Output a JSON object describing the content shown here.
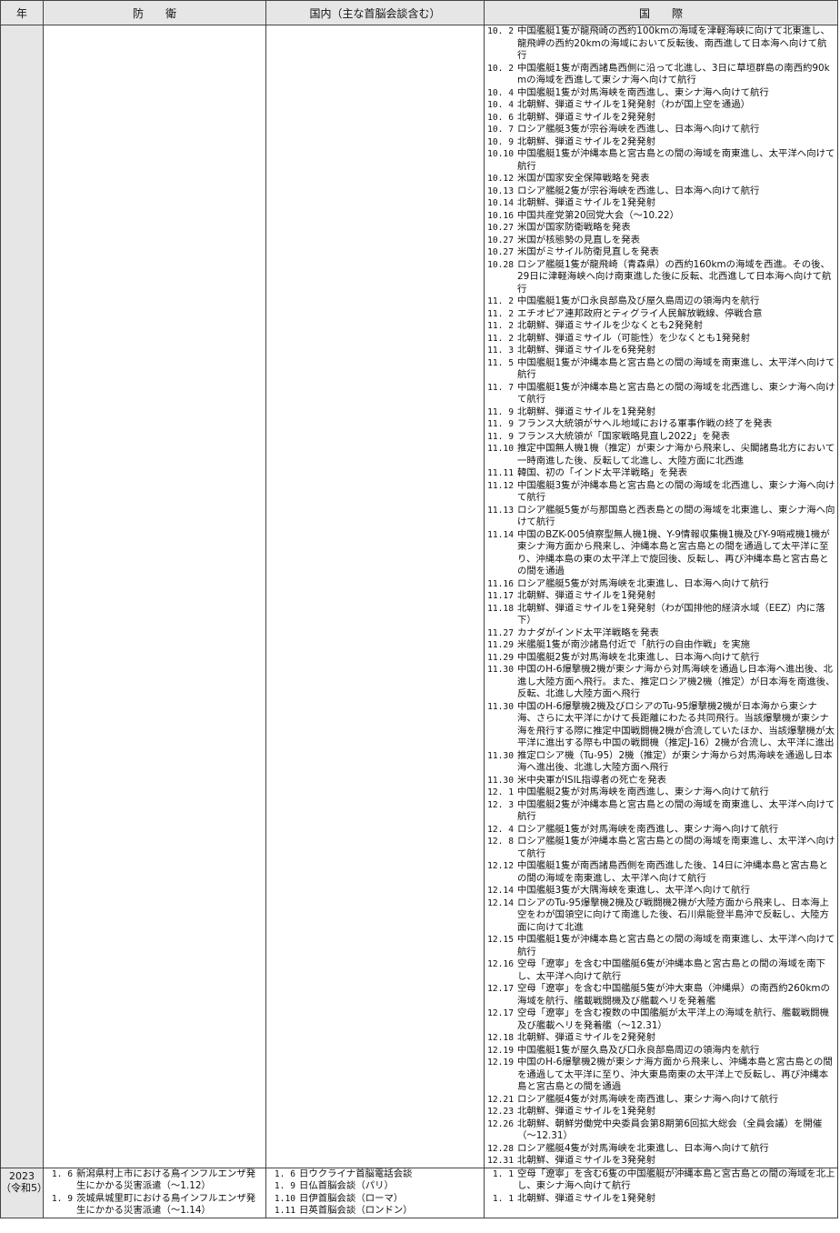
{
  "header": {
    "year": "年",
    "defense": "防　　衛",
    "domestic": "国内（主な首脳会談含む）",
    "international": "国　　際"
  },
  "rows": [
    {
      "year": "",
      "defense": [],
      "domestic": [],
      "international": [
        {
          "date": "10. 2",
          "text": "中国艦艇1隻が龍飛崎の西約100kmの海域を津軽海峡に向けて北東進し、龍飛岬の西約20kmの海域において反転後、南西進して日本海へ向けて航行"
        },
        {
          "date": "10. 2",
          "text": "中国艦艇1隻が南西諸島西側に沿って北進し、3日に草垣群島の南西約90kmの海域を西進して東シナ海へ向けて航行"
        },
        {
          "date": "10. 4",
          "text": "中国艦艇1隻が対馬海峡を南西進し、東シナ海へ向けて航行"
        },
        {
          "date": "10. 4",
          "text": "北朝鮮、弾道ミサイルを1発発射（わが国上空を通過）"
        },
        {
          "date": "10. 6",
          "text": "北朝鮮、弾道ミサイルを2発発射"
        },
        {
          "date": "10. 7",
          "text": "ロシア艦艇3隻が宗谷海峡を西進し、日本海へ向けて航行"
        },
        {
          "date": "10. 9",
          "text": "北朝鮮、弾道ミサイルを2発発射"
        },
        {
          "date": "10.10",
          "text": "中国艦艇1隻が沖縄本島と宮古島との間の海域を南東進し、太平洋へ向けて航行"
        },
        {
          "date": "10.12",
          "text": "米国が国家安全保障戦略を発表"
        },
        {
          "date": "10.13",
          "text": "ロシア艦艇2隻が宗谷海峡を西進し、日本海へ向けて航行"
        },
        {
          "date": "10.14",
          "text": "北朝鮮、弾道ミサイルを1発発射"
        },
        {
          "date": "10.16",
          "text": "中国共産党第20回党大会（～10.22）"
        },
        {
          "date": "10.27",
          "text": "米国が国家防衛戦略を発表"
        },
        {
          "date": "10.27",
          "text": "米国が核態勢の見直しを発表"
        },
        {
          "date": "10.27",
          "text": "米国がミサイル防衛見直しを発表"
        },
        {
          "date": "10.28",
          "text": "ロシア艦艇1隻が龍飛崎（青森県）の西約160kmの海域を西進。その後、29日に津軽海峡へ向け南東進した後に反転、北西進して日本海へ向けて航行"
        },
        {
          "date": "11. 2",
          "text": "中国艦艇1隻が口永良部島及び屋久島周辺の領海内を航行"
        },
        {
          "date": "11. 2",
          "text": "エチオピア連邦政府とティグライ人民解放戦線、停戦合意"
        },
        {
          "date": "11. 2",
          "text": "北朝鮮、弾道ミサイルを少なくとも2発発射"
        },
        {
          "date": "11. 2",
          "text": "北朝鮮、弾道ミサイル（可能性）を少なくとも1発発射"
        },
        {
          "date": "11. 3",
          "text": "北朝鮮、弾道ミサイルを6発発射"
        },
        {
          "date": "11. 5",
          "text": "中国艦艇1隻が沖縄本島と宮古島との間の海域を南東進し、太平洋へ向けて航行"
        },
        {
          "date": "11. 7",
          "text": "中国艦艇1隻が沖縄本島と宮古島との間の海域を北西進し、東シナ海へ向けて航行"
        },
        {
          "date": "11. 9",
          "text": "北朝鮮、弾道ミサイルを1発発射"
        },
        {
          "date": "11. 9",
          "text": "フランス大統領がサヘル地域における軍事作戦の終了を発表"
        },
        {
          "date": "11. 9",
          "text": "フランス大統領が「国家戦略見直し2022」を発表"
        },
        {
          "date": "11.10",
          "text": "推定中国無人機1機（推定）が東シナ海から飛来し、尖閣諸島北方において一時南進した後、反転して北進し、大陸方面に北西進"
        },
        {
          "date": "11.11",
          "text": "韓国、初の「インド太平洋戦略」を発表"
        },
        {
          "date": "11.12",
          "text": "中国艦艇3隻が沖縄本島と宮古島との間の海域を北西進し、東シナ海へ向けて航行"
        },
        {
          "date": "11.13",
          "text": "ロシア艦艇5隻が与那国島と西表島との間の海域を北東進し、東シナ海へ向けて航行"
        },
        {
          "date": "11.14",
          "text": "中国のBZK-005偵察型無人機1機、Y-9情報収集機1機及びY-9哨戒機1機が東シナ海方面から飛来し、沖縄本島と宮古島との間を通過して太平洋に至り、沖縄本島の東の太平洋上で旋回後、反転し、再び沖縄本島と宮古島との間を通過"
        },
        {
          "date": "11.16",
          "text": "ロシア艦艇5隻が対馬海峡を北東進し、日本海へ向けて航行"
        },
        {
          "date": "11.17",
          "text": "北朝鮮、弾道ミサイルを1発発射"
        },
        {
          "date": "11.18",
          "text": "北朝鮮、弾道ミサイルを1発発射（わが国排他的経済水域（EEZ）内に落下）"
        },
        {
          "date": "11.27",
          "text": "カナダがインド太平洋戦略を発表"
        },
        {
          "date": "11.29",
          "text": "米艦艇1隻が南沙諸島付近で「航行の自由作戦」を実施"
        },
        {
          "date": "11.29",
          "text": "中国艦艇2隻が対馬海峡を北東進し、日本海へ向けて航行"
        },
        {
          "date": "11.30",
          "text": "中国のH-6爆撃機2機が東シナ海から対馬海峡を通過し日本海へ進出後、北進し大陸方面へ飛行。また、推定ロシア機2機（推定）が日本海を南進後、反転、北進し大陸方面へ飛行"
        },
        {
          "date": "11.30",
          "text": "中国のH-6爆撃機2機及びロシアのTu-95爆撃機2機が日本海から東シナ海、さらに太平洋にかけて長距離にわたる共同飛行。当該爆撃機が東シナ海を飛行する際に推定中国戦闘機2機が合流していたほか、当該爆撃機が太平洋に進出する際も中国の戦闘機（推定J-16）2機が合流し、太平洋に進出"
        },
        {
          "date": "11.30",
          "text": "推定ロシア機（Tu-95）2機（推定）が東シナ海から対馬海峡を通過し日本海へ進出後、北進し大陸方面へ飛行"
        },
        {
          "date": "11.30",
          "text": "米中央軍がISIL指導者の死亡を発表"
        },
        {
          "date": "12. 1",
          "text": "中国艦艇2隻が対馬海峡を南西進し、東シナ海へ向けて航行"
        },
        {
          "date": "12. 3",
          "text": "中国艦艇2隻が沖縄本島と宮古島との間の海域を南東進し、太平洋へ向けて航行"
        },
        {
          "date": "12. 4",
          "text": "ロシア艦艇1隻が対馬海峡を南西進し、東シナ海へ向けて航行"
        },
        {
          "date": "12. 8",
          "text": "ロシア艦艇1隻が沖縄本島と宮古島との間の海域を南東進し、太平洋へ向けて航行"
        },
        {
          "date": "12.12",
          "text": "中国艦艇1隻が南西諸島西側を南西進した後、14日に沖縄本島と宮古島との間の海域を南東進し、太平洋へ向けて航行"
        },
        {
          "date": "12.14",
          "text": "中国艦艇3隻が大隅海峡を東進し、太平洋へ向けて航行"
        },
        {
          "date": "12.14",
          "text": "ロシアのTu-95爆撃機2機及び戦闘機2機が大陸方面から飛来し、日本海上空をわが国領空に向けて南進した後、石川県能登半島沖で反転し、大陸方面に向けて北進"
        },
        {
          "date": "12.15",
          "text": "中国艦艇1隻が沖縄本島と宮古島との間の海域を南東進し、太平洋へ向けて航行"
        },
        {
          "date": "12.16",
          "text": "空母「遼寧」を含む中国艦艇6隻が沖縄本島と宮古島との間の海域を南下し、太平洋へ向けて航行"
        },
        {
          "date": "12.17",
          "text": "空母「遼寧」を含む中国艦艇5隻が沖大東島（沖縄県）の南西約260kmの海域を航行、艦載戦闘機及び艦載ヘリを発着艦"
        },
        {
          "date": "12.17",
          "text": "空母「遼寧」を含む複数の中国艦艇が太平洋上の海域を航行、艦載戦闘機及び艦載ヘリを発着艦（～12.31）"
        },
        {
          "date": "12.18",
          "text": "北朝鮮、弾道ミサイルを2発発射"
        },
        {
          "date": "12.19",
          "text": "中国艦艇1隻が屋久島及び口永良部島周辺の領海内を航行"
        },
        {
          "date": "12.19",
          "text": "中国のH-6爆撃機2機が東シナ海方面から飛来し、沖縄本島と宮古島との間を通過して太平洋に至り、沖大東島南東の太平洋上で反転し、再び沖縄本島と宮古島との間を通過"
        },
        {
          "date": "12.21",
          "text": "ロシア艦艇4隻が対馬海峡を南西進し、東シナ海へ向けて航行"
        },
        {
          "date": "12.23",
          "text": "北朝鮮、弾道ミサイルを1発発射"
        },
        {
          "date": "12.26",
          "text": "北朝鮮、朝鮮労働党中央委員会第8期第6回拡大総会（全員会議）を開催（～12.31）"
        },
        {
          "date": "12.28",
          "text": "ロシア艦艇4隻が対馬海峡を北東進し、日本海へ向けて航行"
        },
        {
          "date": "12.31",
          "text": "北朝鮮、弾道ミサイルを3発発射"
        }
      ]
    },
    {
      "year": "2023\n（令和5）",
      "defense": [
        {
          "date": "1. 6",
          "text": "新潟県村上市における鳥インフルエンザ発生にかかる災害派遣（～1.12）"
        },
        {
          "date": "1. 9",
          "text": "茨城県城里町における鳥インフルエンザ発生にかかる災害派遣（～1.14）"
        }
      ],
      "domestic": [
        {
          "date": "1. 6",
          "text": "日ウクライナ首脳電話会談"
        },
        {
          "date": "1. 9",
          "text": "日仏首脳会談（パリ）"
        },
        {
          "date": "1.10",
          "text": "日伊首脳会談（ローマ）"
        },
        {
          "date": "1.11",
          "text": "日英首脳会談（ロンドン）"
        }
      ],
      "international": [
        {
          "date": "1. 1",
          "text": "空母「遼寧」を含む6隻の中国艦艇が沖縄本島と宮古島との間の海域を北上し、東シナ海へ向けて航行"
        },
        {
          "date": "1. 1",
          "text": "北朝鮮、弾道ミサイルを1発発射"
        }
      ]
    }
  ]
}
